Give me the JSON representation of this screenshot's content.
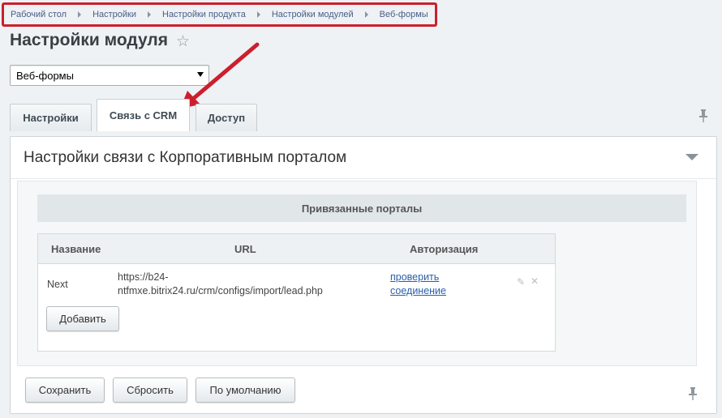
{
  "breadcrumb": [
    "Рабочий стол",
    "Настройки",
    "Настройки продукта",
    "Настройки модулей",
    "Веб-формы"
  ],
  "page": {
    "title": "Настройки модуля"
  },
  "module_select": {
    "value": "Веб-формы"
  },
  "tabs": [
    {
      "label": "Настройки"
    },
    {
      "label": "Связь с CRM"
    },
    {
      "label": "Доступ"
    }
  ],
  "panel": {
    "header": "Настройки связи с Корпоративным порталом",
    "portals_title": "Привязанные порталы",
    "table": {
      "columns": [
        "Название",
        "URL",
        "Авторизация"
      ],
      "rows": [
        {
          "name": "Next",
          "url_line1": "https://b24-",
          "url_line2": "ntfmxe.bitrix24.ru/crm/configs/import/lead.php",
          "auth_line1": "проверить",
          "auth_line2": "соединение"
        }
      ]
    },
    "add_button": "Добавить"
  },
  "footer_buttons": {
    "save": "Сохранить",
    "reset": "Сбросить",
    "default": "По умолчанию"
  },
  "colors": {
    "highlight": "#cc1f2e",
    "link": "#2a5faa"
  }
}
